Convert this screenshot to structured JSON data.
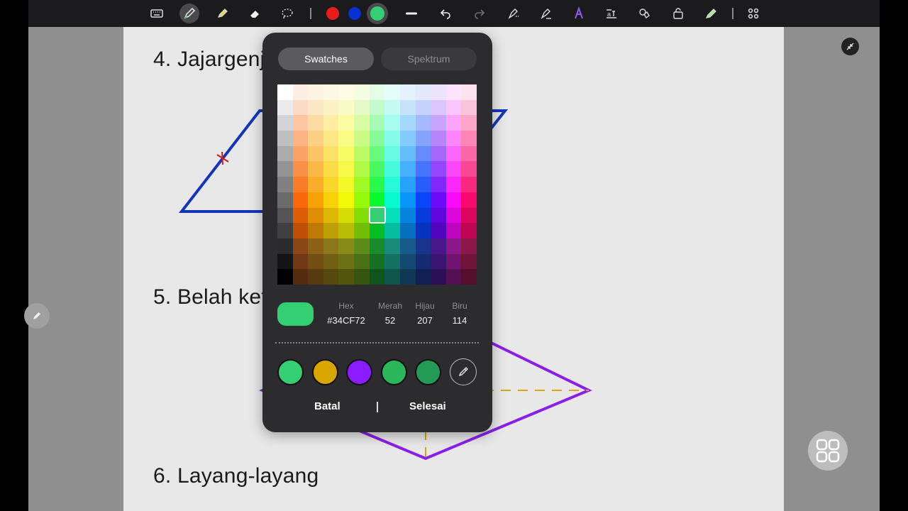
{
  "toolbar": {
    "tools": [
      "keyboard-icon",
      "pen-icon",
      "highlighter-icon",
      "eraser-icon",
      "lasso-icon"
    ],
    "colors": [
      "#e81c1c",
      "#0a2fd0",
      "#34cf72"
    ],
    "active_color": "#34cf72",
    "actions": [
      "undo-icon",
      "redo-icon",
      "shape-fill-icon",
      "magic-pen-icon",
      "text-style-icon",
      "text-box-icon",
      "shapes-icon",
      "lock-icon",
      "marker-icon",
      "apps-icon"
    ]
  },
  "document": {
    "headings": [
      "4. Jajargenjang",
      "5. Belah ketupat",
      "6. Layang-layang"
    ]
  },
  "color_picker": {
    "tabs": [
      "Swatches",
      "Spektrum"
    ],
    "active_tab": "Swatches",
    "selected_color": "#34CF72",
    "labels": {
      "hex": "Hex",
      "red": "Merah",
      "green": "Hijau",
      "blue": "Biru"
    },
    "values": {
      "hex": "#34CF72",
      "red": "52",
      "green": "207",
      "blue": "114"
    },
    "recent_colors": [
      "#34cf72",
      "#d9a600",
      "#8a1cff",
      "#2bb65c",
      "#249a57"
    ],
    "cancel_label": "Batal",
    "done_label": "Selesai"
  }
}
